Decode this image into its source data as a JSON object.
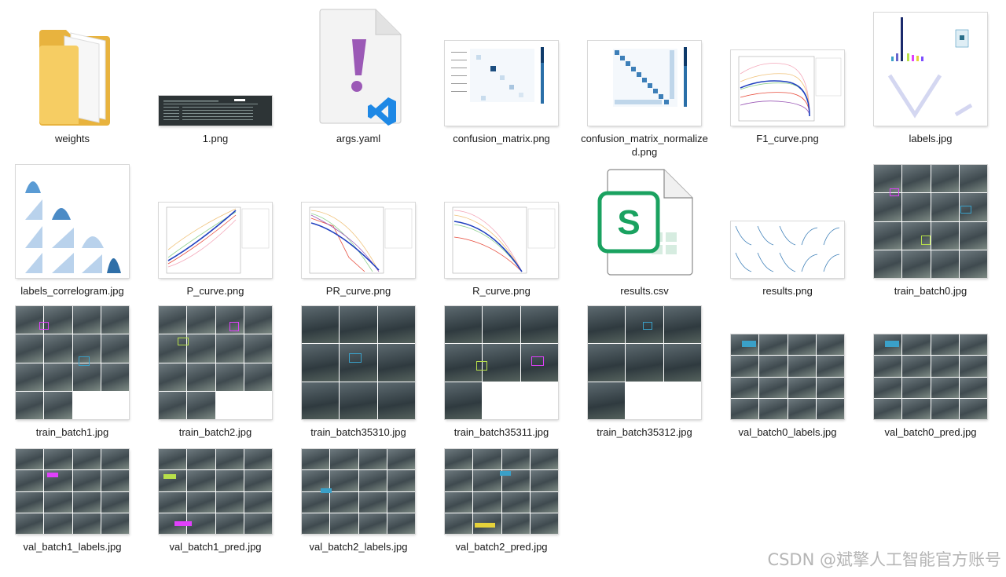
{
  "files": [
    {
      "name": "weights",
      "icon": "folder-icon"
    },
    {
      "name": "1.png",
      "icon": "image-thumbnail"
    },
    {
      "name": "args.yaml",
      "icon": "yaml-file-icon"
    },
    {
      "name": "confusion_matrix.png",
      "icon": "image-thumbnail"
    },
    {
      "name": "confusion_matrix_normalized.png",
      "icon": "image-thumbnail"
    },
    {
      "name": "F1_curve.png",
      "icon": "image-thumbnail"
    },
    {
      "name": "labels.jpg",
      "icon": "image-thumbnail"
    },
    {
      "name": "labels_correlogram.jpg",
      "icon": "image-thumbnail"
    },
    {
      "name": "P_curve.png",
      "icon": "image-thumbnail"
    },
    {
      "name": "PR_curve.png",
      "icon": "image-thumbnail"
    },
    {
      "name": "R_curve.png",
      "icon": "image-thumbnail"
    },
    {
      "name": "results.csv",
      "icon": "spreadsheet-file-icon"
    },
    {
      "name": "results.png",
      "icon": "image-thumbnail"
    },
    {
      "name": "train_batch0.jpg",
      "icon": "image-thumbnail"
    },
    {
      "name": "train_batch1.jpg",
      "icon": "image-thumbnail"
    },
    {
      "name": "train_batch2.jpg",
      "icon": "image-thumbnail"
    },
    {
      "name": "train_batch35310.jpg",
      "icon": "image-thumbnail"
    },
    {
      "name": "train_batch35311.jpg",
      "icon": "image-thumbnail"
    },
    {
      "name": "train_batch35312.jpg",
      "icon": "image-thumbnail"
    },
    {
      "name": "val_batch0_labels.jpg",
      "icon": "image-thumbnail"
    },
    {
      "name": "val_batch0_pred.jpg",
      "icon": "image-thumbnail"
    },
    {
      "name": "val_batch1_labels.jpg",
      "icon": "image-thumbnail"
    },
    {
      "name": "val_batch1_pred.jpg",
      "icon": "image-thumbnail"
    },
    {
      "name": "val_batch2_labels.jpg",
      "icon": "image-thumbnail"
    },
    {
      "name": "val_batch2_pred.jpg",
      "icon": "image-thumbnail"
    }
  ],
  "colors": {
    "folder": "#f3c95b",
    "yaml_mark": "#9b59b6",
    "vscode": "#1e88e5",
    "spreadsheet": "#1aa260"
  },
  "watermark": "CSDN @斌擎人工智能官方账号"
}
